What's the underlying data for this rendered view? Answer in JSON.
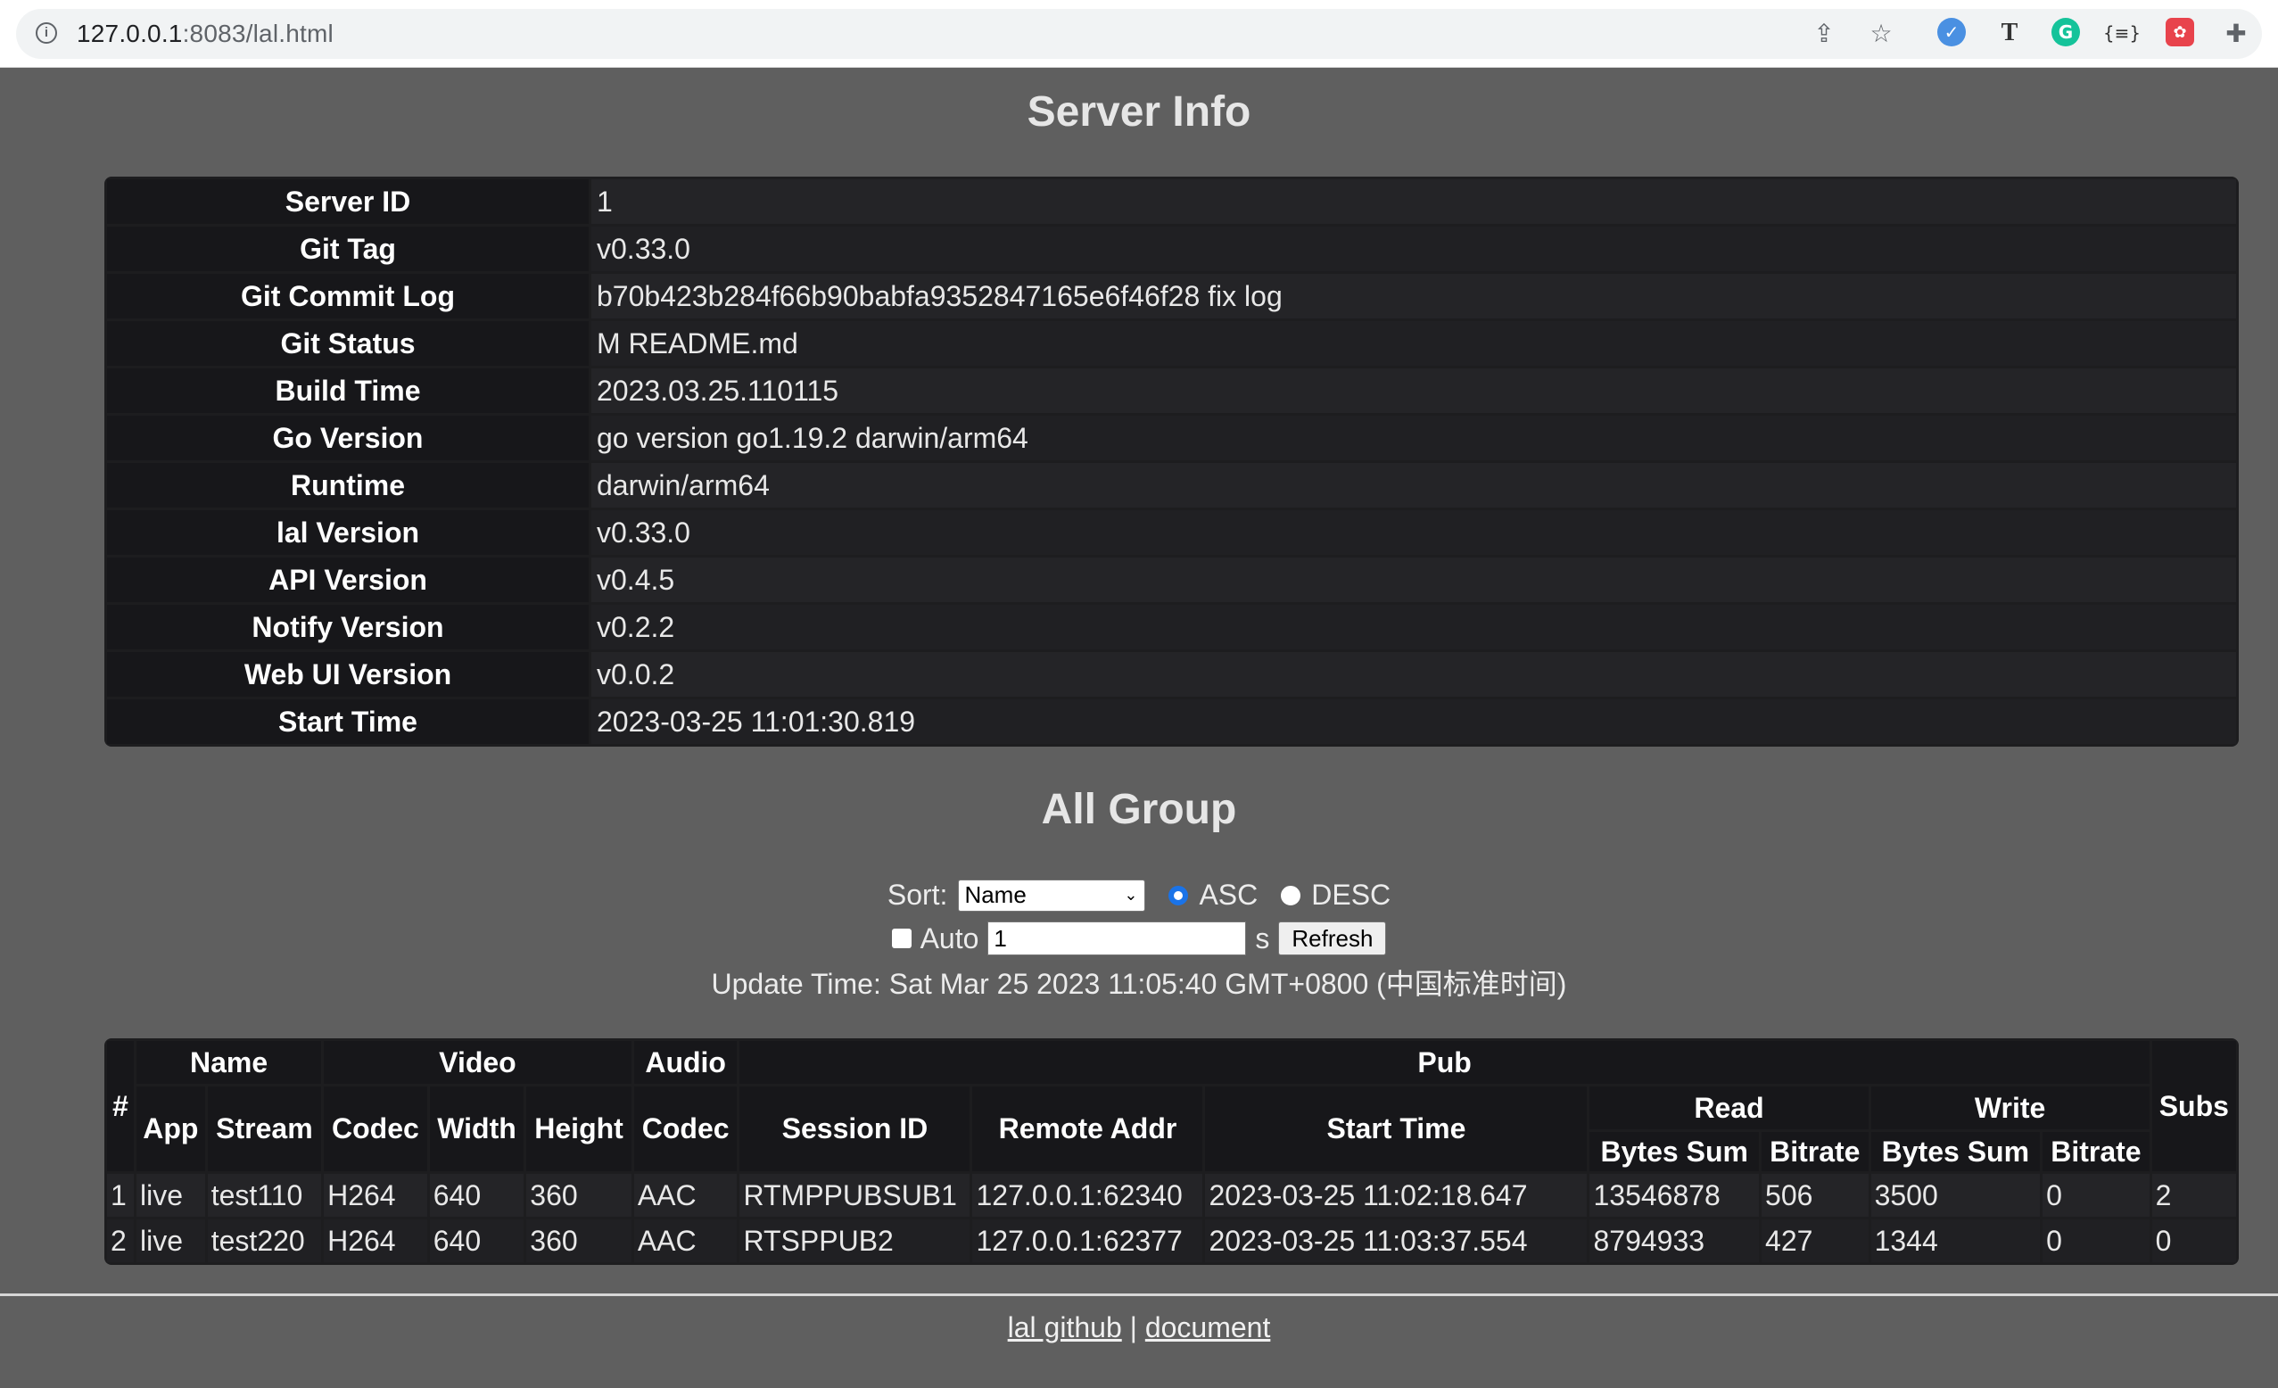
{
  "browser": {
    "url_host": "127.0.0.1",
    "url_path": ":8083/lal.html"
  },
  "server_info": {
    "title": "Server Info",
    "rows": [
      {
        "key": "Server ID",
        "value": "1"
      },
      {
        "key": "Git Tag",
        "value": "v0.33.0"
      },
      {
        "key": "Git Commit Log",
        "value": "b70b423b284f66b90babfa9352847165e6f46f28 fix log"
      },
      {
        "key": "Git Status",
        "value": "M README.md"
      },
      {
        "key": "Build Time",
        "value": "2023.03.25.110115"
      },
      {
        "key": "Go Version",
        "value": "go version go1.19.2 darwin/arm64"
      },
      {
        "key": "Runtime",
        "value": "darwin/arm64"
      },
      {
        "key": "lal Version",
        "value": "v0.33.0"
      },
      {
        "key": "API Version",
        "value": "v0.4.5"
      },
      {
        "key": "Notify Version",
        "value": "v0.2.2"
      },
      {
        "key": "Web UI Version",
        "value": "v0.0.2"
      },
      {
        "key": "Start Time",
        "value": "2023-03-25 11:01:30.819"
      }
    ]
  },
  "all_group": {
    "title": "All Group",
    "sort_label": "Sort:",
    "sort_selected": "Name",
    "asc_label": "ASC",
    "desc_label": "DESC",
    "auto_label": "Auto",
    "auto_value": "1",
    "seconds_unit": "s",
    "refresh_label": "Refresh",
    "update_time": "Update Time: Sat Mar 25 2023 11:05:40 GMT+0800 (中国标准时间)",
    "headers": {
      "hash": "#",
      "name": "Name",
      "video": "Video",
      "audio": "Audio",
      "pub": "Pub",
      "subs": "Subs",
      "app": "App",
      "stream": "Stream",
      "video_codec": "Codec",
      "width": "Width",
      "height": "Height",
      "audio_codec": "Codec",
      "session_id": "Session ID",
      "remote_addr": "Remote Addr",
      "start_time": "Start Time",
      "read": "Read",
      "write": "Write",
      "read_bytes": "Bytes Sum",
      "read_bitrate": "Bitrate",
      "write_bytes": "Bytes Sum",
      "write_bitrate": "Bitrate"
    },
    "rows": [
      {
        "idx": "1",
        "app": "live",
        "stream": "test110",
        "vcodec": "H264",
        "width": "640",
        "height": "360",
        "acodec": "AAC",
        "session": "RTMPPUBSUB1",
        "remote": "127.0.0.1:62340",
        "start": "2023-03-25 11:02:18.647",
        "rbytes": "13546878",
        "rbitrate": "506",
        "wbytes": "3500",
        "wbitrate": "0",
        "subs": "2"
      },
      {
        "idx": "2",
        "app": "live",
        "stream": "test220",
        "vcodec": "H264",
        "width": "640",
        "height": "360",
        "acodec": "AAC",
        "session": "RTSPPUB2",
        "remote": "127.0.0.1:62377",
        "start": "2023-03-25 11:03:37.554",
        "rbytes": "8794933",
        "rbitrate": "427",
        "wbytes": "1344",
        "wbitrate": "0",
        "subs": "0"
      }
    ]
  },
  "footer": {
    "github_link": "lal github",
    "separator": "|",
    "document_link": "document"
  }
}
